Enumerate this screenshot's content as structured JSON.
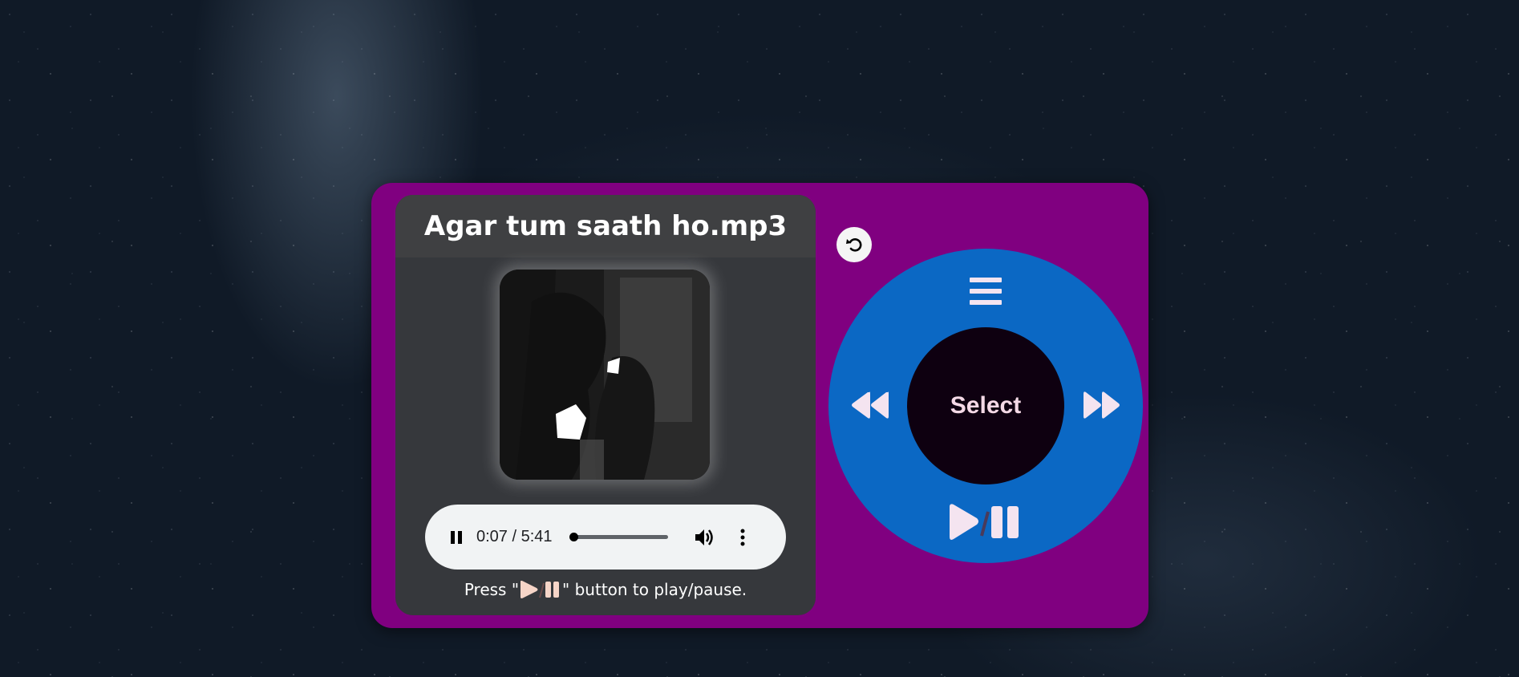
{
  "player": {
    "track_title": "Agar tum saath ho.mp3",
    "current_time": "0:07",
    "duration": "5:41",
    "time_display": "0:07 / 5:41",
    "progress_fraction": 0.02,
    "hint_prefix": "Press \"",
    "hint_suffix": "\" button to play/pause."
  },
  "wheel": {
    "select_label": "Select",
    "menu_icon": "menu-icon",
    "rewind_icon": "rewind-icon",
    "fast_forward_icon": "fast-forward-icon",
    "play_pause_icon": "play-pause-icon"
  },
  "controls": {
    "reset_icon": "rotate-ccw-icon",
    "pause_icon": "pause-icon",
    "volume_icon": "volume-icon",
    "more_icon": "more-vertical-icon"
  },
  "colors": {
    "body": "#800080",
    "screen": "#36383c",
    "wheel": "#0b68c4",
    "select": "#0e0010",
    "wheel_icons": "#f4e4f0"
  }
}
